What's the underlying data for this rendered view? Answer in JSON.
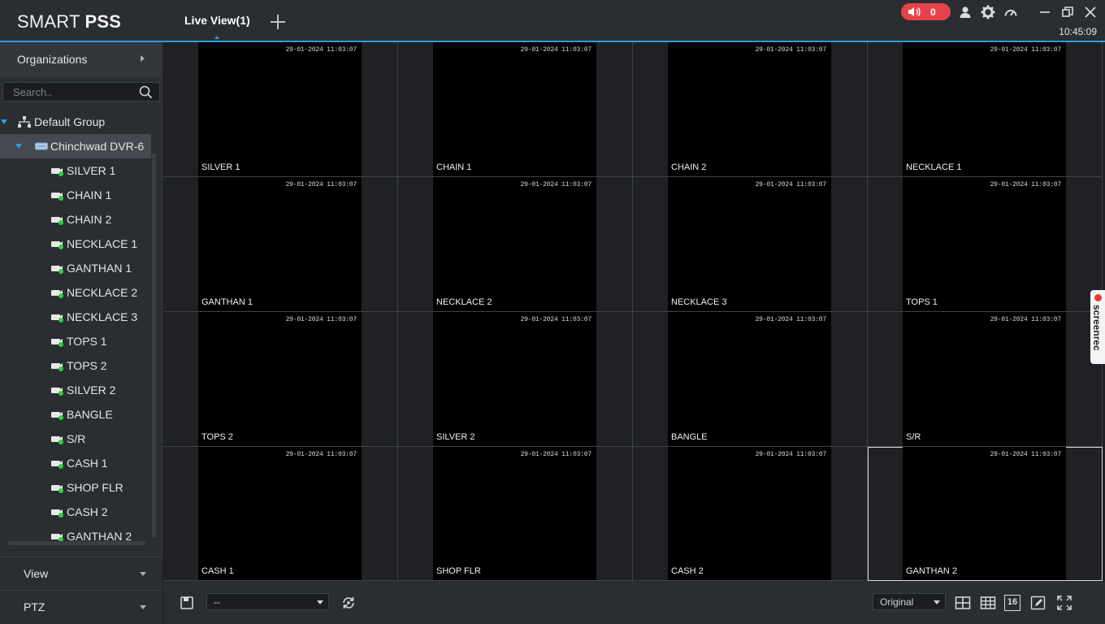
{
  "header": {
    "logo_light": "SMART ",
    "logo_bold": "PSS",
    "tab_label": "Live View(1)",
    "alarm_count": "0",
    "clock": "10:45:09",
    "colors": {
      "accent": "#2f9be0",
      "alarm": "#e5434b"
    }
  },
  "sidebar": {
    "organizations_label": "Organizations",
    "search_placeholder": "Search..",
    "group_label": "Default Group",
    "device_label": "Chinchwad DVR-6",
    "channels": [
      "SILVER 1",
      "CHAIN 1",
      "CHAIN 2",
      "NECKLACE 1",
      "GANTHAN 1",
      "NECKLACE 2",
      "NECKLACE 3",
      "TOPS 1",
      "TOPS 2",
      "SILVER 2",
      "BANGLE",
      "S/R",
      "CASH 1",
      "SHOP FLR",
      "CASH 2",
      "GANTHAN 2"
    ],
    "view_label": "View",
    "ptz_label": "PTZ"
  },
  "grid": {
    "cells": [
      {
        "name": "SILVER 1",
        "ts": "29-01-2024 11:03:07"
      },
      {
        "name": "CHAIN 1",
        "ts": "29-01-2024 11:03:07"
      },
      {
        "name": "CHAIN 2",
        "ts": "29-01-2024 11:03:07"
      },
      {
        "name": "NECKLACE 1",
        "ts": "29-01-2024 11:03:07"
      },
      {
        "name": "GANTHAN 1",
        "ts": "29-01-2024 11:03:07"
      },
      {
        "name": "NECKLACE 2",
        "ts": "29-01-2024 11:03:07"
      },
      {
        "name": "NECKLACE 3",
        "ts": "29-01-2024 11:03:07"
      },
      {
        "name": "TOPS 1",
        "ts": "29-01-2024 11:03:07"
      },
      {
        "name": "TOPS 2",
        "ts": "29-01-2024 11:03:07"
      },
      {
        "name": "SILVER 2",
        "ts": "29-01-2024 11:03:07"
      },
      {
        "name": "BANGLE",
        "ts": "29-01-2024 11:03:07"
      },
      {
        "name": "S/R",
        "ts": "29-01-2024 11:03:07"
      },
      {
        "name": "CASH 1",
        "ts": "29-01-2024 11:03:07"
      },
      {
        "name": "SHOP FLR",
        "ts": "29-01-2024 11:03:07"
      },
      {
        "name": "CASH 2",
        "ts": "29-01-2024 11:03:07"
      },
      {
        "name": "GANTHAN 2",
        "ts": "29-01-2024 11:03:07"
      }
    ]
  },
  "toolbar": {
    "view_select": "--",
    "stream_select": "Original",
    "split16_label": "16"
  },
  "screenrec_label": "screenrec"
}
